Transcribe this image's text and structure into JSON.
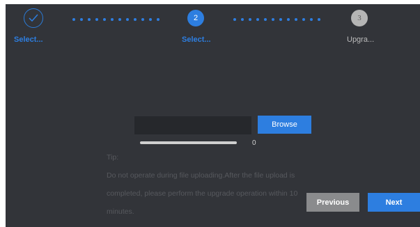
{
  "colors": {
    "background": "#323439",
    "accent": "#2d7ee0",
    "disabled_button": "#8a8b8d",
    "tip_text": "#57595e"
  },
  "steps": [
    {
      "number": "",
      "label": "Select...",
      "state": "done",
      "icon": "check-circle-icon"
    },
    {
      "number": "2",
      "label": "Select...",
      "state": "active"
    },
    {
      "number": "3",
      "label": "Upgra...",
      "state": "pending"
    }
  ],
  "upload": {
    "file_value": "",
    "browse_label": "Browse",
    "progress_value": "0",
    "progress_fraction": 0
  },
  "tip": {
    "heading": "Tip:",
    "body": "Do not operate during file uploading.After the file upload is completed, please perform the upgrade operation within 10 minutes."
  },
  "buttons": {
    "previous": "Previous",
    "next": "Next"
  }
}
